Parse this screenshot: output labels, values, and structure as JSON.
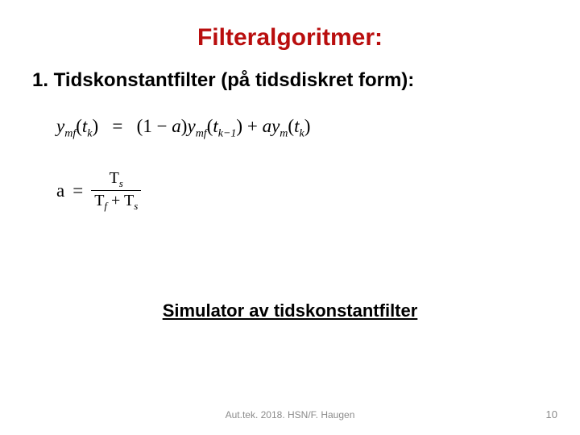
{
  "title": "Filteralgoritmer:",
  "section_heading": "1. Tidskonstantfilter (på tidsdiskret form):",
  "formula1": {
    "lhs_y": "y",
    "lhs_sub": "mf",
    "lhs_arg_t": "t",
    "lhs_arg_k": "k",
    "eq": "=",
    "term1_open": "(1 − ",
    "term1_a": "a",
    "term1_close": ")",
    "term1_y": "y",
    "term1_sub": "mf",
    "term1_arg_t": "t",
    "term1_arg_k": "k−1",
    "plus": " + ",
    "term2_a": "a",
    "term2_y": "y",
    "term2_sub": "m",
    "term2_arg_t": "t",
    "term2_arg_k": "k"
  },
  "formula2": {
    "a": "a",
    "eq": "=",
    "num_T": "T",
    "num_sub": "s",
    "den_Tf": "T",
    "den_Tf_sub": "f",
    "den_plus": " + ",
    "den_Ts": "T",
    "den_Ts_sub": "s"
  },
  "link_text": "Simulator av tidskonstantfilter",
  "footer": "Aut.tek. 2018. HSN/F. Haugen",
  "page_number": "10"
}
